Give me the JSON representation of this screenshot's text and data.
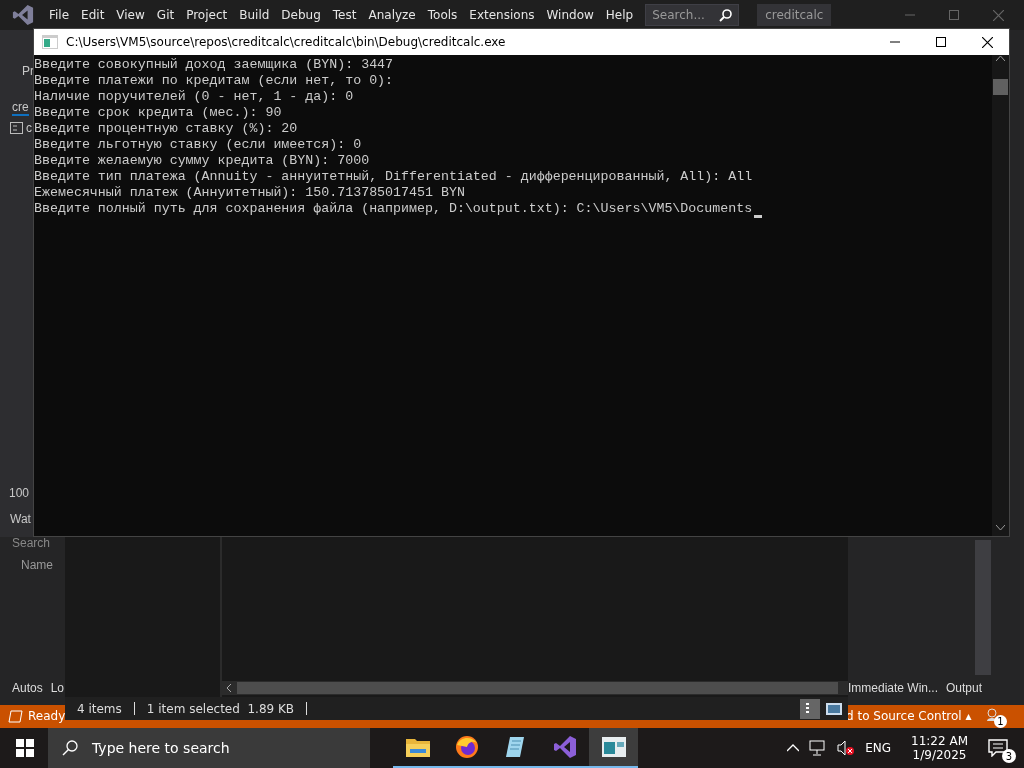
{
  "ide": {
    "menu": [
      "File",
      "Edit",
      "View",
      "Git",
      "Project",
      "Build",
      "Debug",
      "Test",
      "Analyze",
      "Tools",
      "Extensions",
      "Window",
      "Help"
    ],
    "search": {
      "placeholder": "Search..."
    },
    "solution_name": "creditcalc",
    "left_fragments": {
      "toolbar": "Pr",
      "doc_tab": "cre",
      "file_item": "c",
      "zoom": "100",
      "panel_title": "Wat",
      "search_placeholder": "Search",
      "column": "Name"
    },
    "bottom_tabs_left": [
      "Autos",
      "Lo"
    ],
    "bottom_tabs_right": [
      "Immediate Win...",
      "Output"
    ],
    "status_bar": {
      "text": "Ready",
      "source_control": "d to Source Control",
      "source_control_caret": "▴",
      "notification_count": "1"
    }
  },
  "explorer": {
    "status_items": [
      "4 items",
      "1 item selected  1.89 KB"
    ]
  },
  "console": {
    "title": "C:\\Users\\VM5\\source\\repos\\creditcalc\\creditcalc\\bin\\Debug\\creditcalc.exe",
    "lines": [
      "Введите совокупный доход заемщика (BYN): 3447",
      "Введите платежи по кредитам (если нет, то 0):",
      "Наличие поручителей (0 - нет, 1 - да): 0",
      "Введите срок кредита (мес.): 90",
      "Введите процентную ставку (%): 20",
      "Введите льготную ставку (если имеется): 0",
      "Введите желаемую сумму кредита (BYN): 7000",
      "Введите тип платежа (Annuity - аннуитетный, Differentiated - дифференцированный, All): All",
      "Ежемесячный платеж (Аннуитетный): 150.713785017451 BYN",
      "Введите полный путь для сохранения файла (например, D:\\output.txt): C:\\Users\\VM5\\Documents"
    ]
  },
  "taskbar": {
    "search_placeholder": "Type here to search",
    "apps": [
      {
        "kind": "folder",
        "selected": false
      },
      {
        "kind": "browser",
        "selected": false
      },
      {
        "kind": "notepad",
        "selected": false
      },
      {
        "kind": "visual-studio",
        "selected": false
      },
      {
        "kind": "console",
        "selected": true
      }
    ],
    "language": "ENG",
    "time": "11:22 AM",
    "date": "1/9/2025",
    "notification_count": "3"
  }
}
